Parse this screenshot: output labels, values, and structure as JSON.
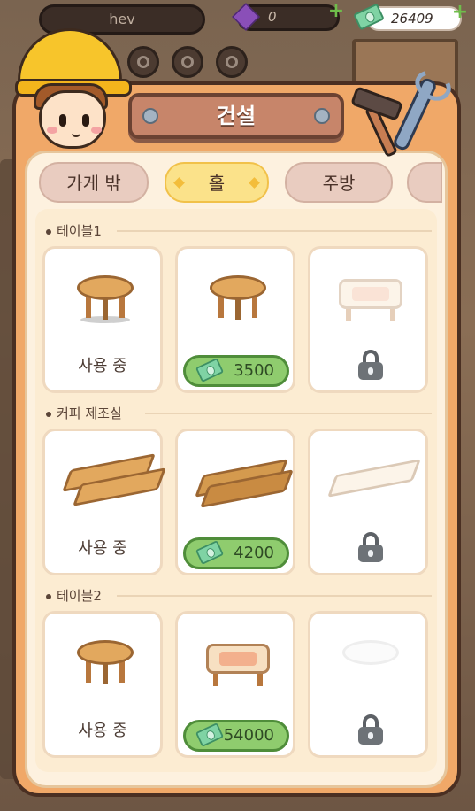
{
  "hud": {
    "player_name": "hev",
    "gems": "0",
    "cash": "26409"
  },
  "panel": {
    "title": "건설"
  },
  "tabs": [
    {
      "label": "가게 밖"
    },
    {
      "label": "홀"
    },
    {
      "label": "주방"
    }
  ],
  "sections": [
    {
      "label": "테이블1",
      "items": [
        {
          "state": "in_use",
          "text": "사용 중"
        },
        {
          "state": "buy",
          "price": "3500"
        },
        {
          "state": "locked"
        }
      ]
    },
    {
      "label": "커피 제조실",
      "items": [
        {
          "state": "in_use",
          "text": "사용 중"
        },
        {
          "state": "buy",
          "price": "4200"
        },
        {
          "state": "locked"
        }
      ]
    },
    {
      "label": "테이블2",
      "items": [
        {
          "state": "in_use",
          "text": "사용 중"
        },
        {
          "state": "buy",
          "price": "54000"
        },
        {
          "state": "locked"
        }
      ]
    }
  ],
  "colors": {
    "panel": "#f0a868",
    "active_tab": "#fbe28a",
    "price_button": "#8fcc6e"
  }
}
